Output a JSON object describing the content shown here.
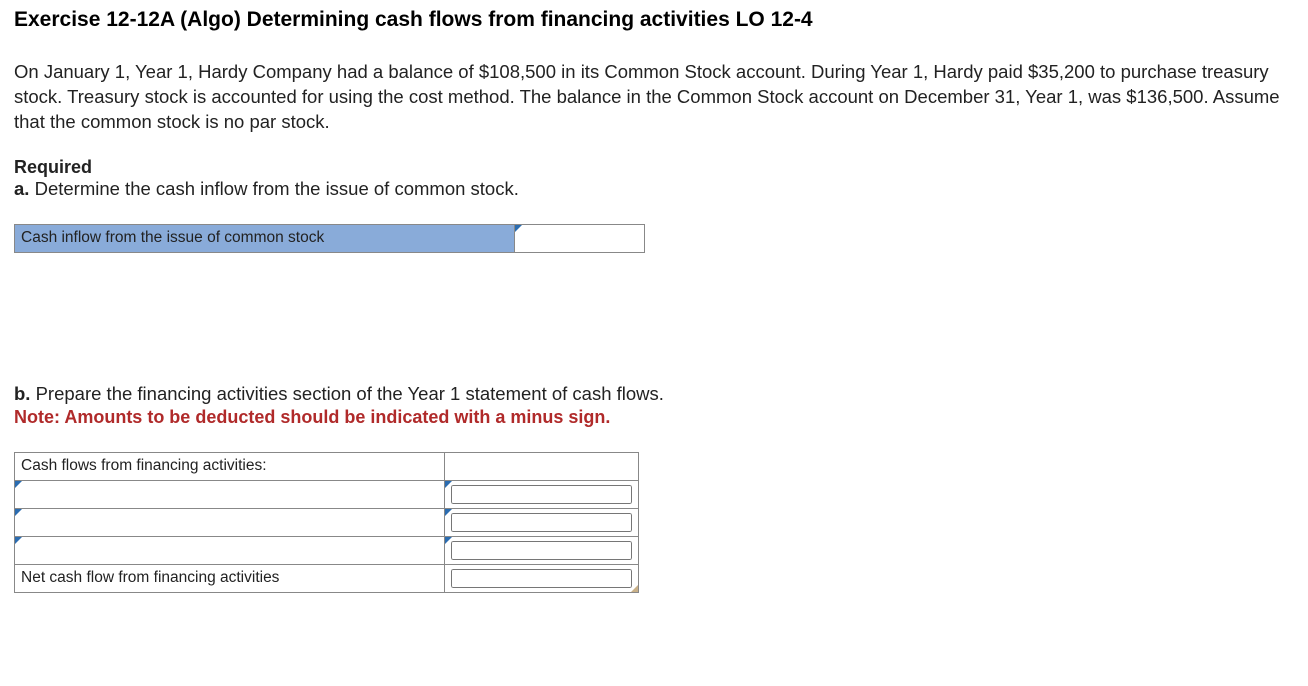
{
  "title": "Exercise 12-12A (Algo) Determining cash flows from financing activities LO 12-4",
  "problem_text": "On January 1, Year 1, Hardy Company had a balance of $108,500 in its Common Stock account. During Year 1, Hardy paid $35,200 to purchase treasury stock. Treasury stock is accounted for using the cost method. The balance in the Common Stock account on December 31, Year 1, was $136,500. Assume that the common stock is no par stock.",
  "required_label": "Required",
  "part_a": {
    "letter": "a.",
    "text": " Determine the cash inflow from the issue of common stock.",
    "row_label": "Cash inflow from the issue of common stock",
    "value": ""
  },
  "part_b": {
    "letter": "b.",
    "text": " Prepare the financing activities section of the Year 1 statement of cash flows.",
    "note": "Note: Amounts to be deducted should be indicated with a minus sign.",
    "header": "Cash flows from financing activities:",
    "rows": [
      {
        "label": "",
        "value": ""
      },
      {
        "label": "",
        "value": ""
      },
      {
        "label": "",
        "value": ""
      }
    ],
    "footer_label": "Net cash flow from financing activities",
    "footer_value": ""
  }
}
